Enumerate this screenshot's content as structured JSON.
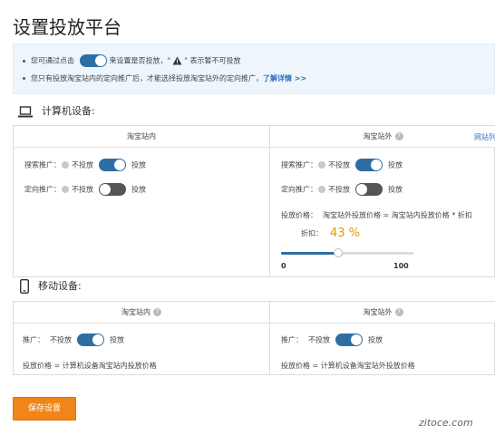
{
  "page": {
    "title": "设置投放平台"
  },
  "notice": {
    "line1_prefix": "您可通过点击",
    "line1_middle": "来设置是否投放，\"",
    "line1_suffix": "\" 表示暂不可投放",
    "line2_text": "您只有投放淘宝站内的定向推广后，才能选择投放淘宝站外的定向推广，",
    "line2_link": "了解详情 >>"
  },
  "pc_section": {
    "label": "计算机设备:",
    "inside": {
      "header": "淘宝站内",
      "search_label": "搜索推广：",
      "search_off": "不投放",
      "search_on": "投放",
      "search_enabled": true,
      "target_label": "定向推广：",
      "target_off": "不投放",
      "target_on": "投放",
      "target_enabled": false
    },
    "outside": {
      "header": "淘宝站外",
      "header_link": "网站列",
      "search_label": "搜索推广：",
      "search_off": "不投放",
      "search_on": "投放",
      "search_enabled": true,
      "target_label": "定向推广：",
      "target_off": "不投放",
      "target_on": "投放",
      "target_enabled": false,
      "price_label": "投放价格：",
      "price_formula": "淘宝站外投放价格 = 淘宝站内投放价格 * 折扣",
      "discount_label": "折扣：",
      "discount_value": "43 %",
      "slider_fraction": 0.43,
      "slider_min": "0",
      "slider_max": "100"
    }
  },
  "mobile_section": {
    "label": "移动设备:",
    "inside": {
      "header": "淘宝站内",
      "promo_label": "推广：",
      "promo_off": "不投放",
      "promo_on": "投放",
      "promo_enabled": true,
      "price_text": "投放价格 =  计算机设备淘宝站内投放价格"
    },
    "outside": {
      "header": "淘宝站外",
      "promo_label": "推广：",
      "promo_off": "不投放",
      "promo_on": "投放",
      "promo_enabled": true,
      "price_text": "投放价格 =  计算机设备淘宝站外投放价格"
    }
  },
  "actions": {
    "save_label": "保存设置"
  },
  "watermark": "zitoce.com",
  "colors": {
    "accent_blue": "#2f6ea4",
    "save_orange": "#f08619",
    "discount_orange": "#e8960c",
    "link_blue": "#2d6fb8",
    "notice_bg": "#eef5fb"
  }
}
